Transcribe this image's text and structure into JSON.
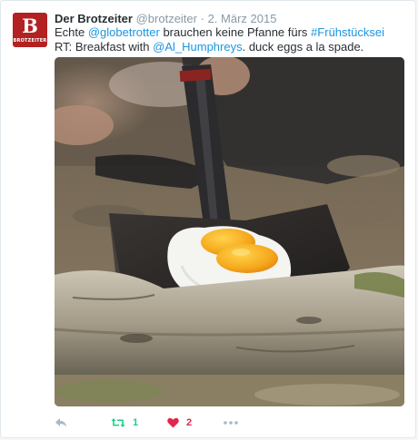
{
  "tweet": {
    "avatar": {
      "big": "B",
      "small": "BROTZEITER"
    },
    "display_name": "Der Brotzeiter",
    "handle": "@brotzeiter",
    "separator": "·",
    "timestamp": "2. März 2015",
    "text": {
      "part1": "Echte ",
      "mention1": "@globetrotter",
      "part2": " brauchen keine Pfanne fürs ",
      "hashtag": "#Frühstücksei",
      "part3": " RT: Breakfast with ",
      "mention2": "@Al_Humphreys",
      "part4": ". duck eggs a la spade."
    },
    "actions": {
      "reply_icon": "reply-icon",
      "retweet_icon": "retweet-icon",
      "retweet_count": "1",
      "like_icon": "heart-icon",
      "like_count": "2",
      "more_icon": "more-icon"
    },
    "colors": {
      "link": "#1b95e0",
      "retweet": "#19cf86",
      "like": "#e2264d",
      "muted": "#8899a6",
      "avatar_bg": "#b22222"
    }
  }
}
